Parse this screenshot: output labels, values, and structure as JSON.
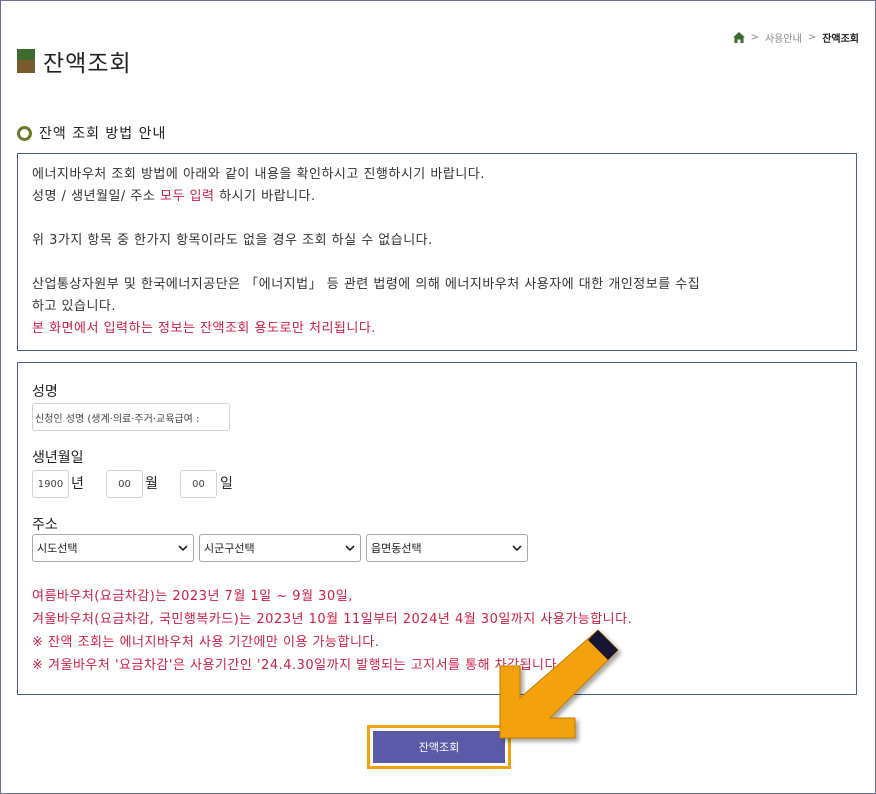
{
  "breadcrumb": {
    "items": [
      "사용안내",
      "잔액조회"
    ]
  },
  "page": {
    "title": "잔액조회"
  },
  "section": {
    "title": "잔액 조회 방법 안내"
  },
  "info": {
    "line1": "에너지바우처 조회 방법에 아래와 같이 내용을 확인하시고 진행하시기 바랍니다.",
    "line2_pre": "성명 / 생년월일/ 주소 ",
    "line2_red": "모두 입력",
    "line2_post": " 하시기 바랍니다.",
    "line3": "위 3가지 항목 중 한가지 항목이라도 없을 경우 조회 하실 수 없습니다.",
    "line4": "산업통상자원부 및 한국에너지공단은 「에너지법」 등 관련 법령에 의해 에너지바우처 사용자에 대한 개인정보를 수집",
    "line5": "하고 있습니다.",
    "line6": "본 화면에서 입력하는 정보는 잔액조회 용도로만 처리됩니다."
  },
  "form": {
    "name_label": "성명",
    "name_placeholder": "신청인 성명 (생계·의료·주거·교육급여 :",
    "birth_label": "생년월일",
    "year_value": "1900",
    "year_suffix": "년",
    "month_value": "00",
    "month_suffix": "월",
    "day_value": "00",
    "day_suffix": "일",
    "address_label": "주소",
    "sido": "시도선택",
    "sigungu": "시군구선택",
    "eupmyeondong": "읍면동선택"
  },
  "notice": {
    "line1": "여름바우처(요금차감)는 2023년 7월 1일 ~ 9월 30일,",
    "line2": "겨울바우처(요금차감, 국민행복카드)는 2023년 10월 11일부터 2024년 4월 30일까지 사용가능합니다.",
    "line3": "※ 잔액 조회는 에너지바우처 사용 기간에만 이용 가능합니다.",
    "line4": "※ 겨울바우처 '요금차감'은 사용기간인 '24.4.30일까지 발행되는 고지서를 통해 차감됩니다."
  },
  "button": {
    "submit": "잔액조회"
  },
  "colors": {
    "accent_red": "#cc1f44",
    "button_bg": "#5a5aa8",
    "highlight": "#f3a20f",
    "border": "#4b5b8c"
  }
}
